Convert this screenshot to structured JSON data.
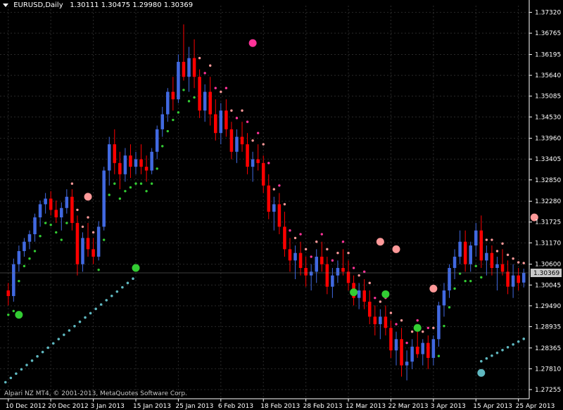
{
  "window": {
    "title_symbol": "EURUSD,Daily",
    "ohlc": "1.30111 1.30475 1.29980 1.30369",
    "copyright": "Alpari NZ MT4, © 2001-2013, MetaQuotes Software Corp."
  },
  "colors": {
    "background": "#000000",
    "bull": "#4169e1",
    "bear": "#ff0000",
    "grid": "#2a2a2a",
    "sar_down": "#ff3399",
    "sar_down_light": "#ff9999",
    "sar_up": "#33cc33",
    "sar_up_slow": "#5fb8c0",
    "current_price_box": "#c8c8c8"
  },
  "chart_data": {
    "type": "candlestick",
    "symbol": "EURUSD",
    "timeframe": "Daily",
    "ylim": [
      1.2701,
      1.375
    ],
    "y_ticks": [
      "1.37320",
      "1.36765",
      "1.36195",
      "1.35640",
      "1.35085",
      "1.34530",
      "1.33960",
      "1.33405",
      "1.32850",
      "1.32280",
      "1.31725",
      "1.31170",
      "1.30600",
      "1.30045",
      "1.29490",
      "1.28935",
      "1.28365",
      "1.27810",
      "1.27255"
    ],
    "current_price": "1.30369",
    "x_labels": [
      "10 Dec 2012",
      "20 Dec 2012",
      "3 Jan 2013",
      "15 Jan 2013",
      "25 Jan 2013",
      "6 Feb 2013",
      "18 Feb 2013",
      "28 Feb 2013",
      "12 Mar 2013",
      "22 Mar 2013",
      "3 Apr 2013",
      "15 Apr 2013",
      "25 Apr 2013"
    ],
    "x_label_index": [
      0,
      8,
      16,
      24,
      32,
      40,
      48,
      56,
      64,
      72,
      80,
      88,
      96
    ],
    "candles": [
      [
        1.299,
        1.301,
        1.295,
        1.2975
      ],
      [
        1.2975,
        1.3075,
        1.296,
        1.306
      ],
      [
        1.306,
        1.311,
        1.304,
        1.3095
      ],
      [
        1.3095,
        1.313,
        1.308,
        1.312
      ],
      [
        1.312,
        1.315,
        1.31,
        1.314
      ],
      [
        1.314,
        1.3195,
        1.312,
        1.3185
      ],
      [
        1.3185,
        1.323,
        1.316,
        1.322
      ],
      [
        1.322,
        1.325,
        1.3195,
        1.3235
      ],
      [
        1.3235,
        1.3255,
        1.319,
        1.3205
      ],
      [
        1.3205,
        1.323,
        1.317,
        1.3185
      ],
      [
        1.3185,
        1.3225,
        1.315,
        1.321
      ],
      [
        1.321,
        1.326,
        1.3195,
        1.324
      ],
      [
        1.324,
        1.326,
        1.315,
        1.317
      ],
      [
        1.317,
        1.319,
        1.303,
        1.306
      ],
      [
        1.306,
        1.3145,
        1.304,
        1.313
      ],
      [
        1.313,
        1.317,
        1.308,
        1.31
      ],
      [
        1.31,
        1.313,
        1.306,
        1.308
      ],
      [
        1.308,
        1.3175,
        1.307,
        1.316
      ],
      [
        1.316,
        1.332,
        1.315,
        1.331
      ],
      [
        1.331,
        1.34,
        1.327,
        1.338
      ],
      [
        1.338,
        1.342,
        1.33,
        1.333
      ],
      [
        1.333,
        1.336,
        1.326,
        1.33
      ],
      [
        1.33,
        1.337,
        1.328,
        1.335
      ],
      [
        1.335,
        1.338,
        1.329,
        1.332
      ],
      [
        1.332,
        1.336,
        1.33,
        1.334
      ],
      [
        1.334,
        1.338,
        1.33,
        1.332
      ],
      [
        1.332,
        1.335,
        1.328,
        1.331
      ],
      [
        1.331,
        1.337,
        1.33,
        1.336
      ],
      [
        1.336,
        1.343,
        1.334,
        1.342
      ],
      [
        1.342,
        1.348,
        1.34,
        1.346
      ],
      [
        1.346,
        1.353,
        1.344,
        1.352
      ],
      [
        1.352,
        1.356,
        1.347,
        1.35
      ],
      [
        1.35,
        1.362,
        1.349,
        1.36
      ],
      [
        1.36,
        1.37,
        1.355,
        1.356
      ],
      [
        1.356,
        1.364,
        1.352,
        1.361
      ],
      [
        1.361,
        1.366,
        1.353,
        1.356
      ],
      [
        1.356,
        1.358,
        1.345,
        1.347
      ],
      [
        1.347,
        1.354,
        1.344,
        1.352
      ],
      [
        1.352,
        1.356,
        1.343,
        1.346
      ],
      [
        1.346,
        1.35,
        1.339,
        1.341
      ],
      [
        1.341,
        1.349,
        1.338,
        1.347
      ],
      [
        1.347,
        1.35,
        1.34,
        1.342
      ],
      [
        1.342,
        1.344,
        1.334,
        1.336
      ],
      [
        1.336,
        1.342,
        1.333,
        1.34
      ],
      [
        1.34,
        1.344,
        1.336,
        1.338
      ],
      [
        1.338,
        1.341,
        1.33,
        1.332
      ],
      [
        1.332,
        1.336,
        1.328,
        1.334
      ],
      [
        1.334,
        1.338,
        1.331,
        1.333
      ],
      [
        1.333,
        1.335,
        1.325,
        1.327
      ],
      [
        1.327,
        1.33,
        1.318,
        1.32
      ],
      [
        1.32,
        1.324,
        1.315,
        1.322
      ],
      [
        1.322,
        1.325,
        1.314,
        1.316
      ],
      [
        1.316,
        1.32,
        1.308,
        1.31
      ],
      [
        1.31,
        1.313,
        1.304,
        1.307
      ],
      [
        1.307,
        1.311,
        1.302,
        1.309
      ],
      [
        1.309,
        1.312,
        1.303,
        1.305
      ],
      [
        1.305,
        1.308,
        1.3,
        1.303
      ],
      [
        1.303,
        1.306,
        1.299,
        1.304
      ],
      [
        1.304,
        1.31,
        1.301,
        1.308
      ],
      [
        1.308,
        1.312,
        1.304,
        1.306
      ],
      [
        1.306,
        1.308,
        1.298,
        1.3
      ],
      [
        1.3,
        1.305,
        1.297,
        1.303
      ],
      [
        1.303,
        1.307,
        1.301,
        1.305
      ],
      [
        1.305,
        1.31,
        1.303,
        1.304
      ],
      [
        1.304,
        1.307,
        1.299,
        1.301
      ],
      [
        1.301,
        1.303,
        1.295,
        1.297
      ],
      [
        1.297,
        1.301,
        1.294,
        1.299
      ],
      [
        1.299,
        1.302,
        1.294,
        1.296
      ],
      [
        1.296,
        1.299,
        1.29,
        1.292
      ],
      [
        1.292,
        1.295,
        1.287,
        1.29
      ],
      [
        1.29,
        1.294,
        1.286,
        1.292
      ],
      [
        1.292,
        1.295,
        1.287,
        1.289
      ],
      [
        1.289,
        1.291,
        1.281,
        1.283
      ],
      [
        1.283,
        1.288,
        1.279,
        1.286
      ],
      [
        1.286,
        1.289,
        1.276,
        1.279
      ],
      [
        1.279,
        1.283,
        1.275,
        1.28
      ],
      [
        1.28,
        1.286,
        1.278,
        1.284
      ],
      [
        1.284,
        1.289,
        1.281,
        1.282
      ],
      [
        1.282,
        1.286,
        1.279,
        1.285
      ],
      [
        1.285,
        1.287,
        1.278,
        1.281
      ],
      [
        1.281,
        1.287,
        1.279,
        1.286
      ],
      [
        1.286,
        1.296,
        1.284,
        1.295
      ],
      [
        1.295,
        1.301,
        1.292,
        1.299
      ],
      [
        1.299,
        1.306,
        1.297,
        1.305
      ],
      [
        1.305,
        1.31,
        1.302,
        1.308
      ],
      [
        1.308,
        1.315,
        1.306,
        1.312
      ],
      [
        1.312,
        1.315,
        1.304,
        1.306
      ],
      [
        1.306,
        1.312,
        1.304,
        1.311
      ],
      [
        1.311,
        1.317,
        1.308,
        1.315
      ],
      [
        1.315,
        1.319,
        1.305,
        1.307
      ],
      [
        1.307,
        1.311,
        1.303,
        1.309
      ],
      [
        1.309,
        1.311,
        1.303,
        1.305
      ],
      [
        1.305,
        1.308,
        1.299,
        1.306
      ],
      [
        1.306,
        1.31,
        1.303,
        1.304
      ],
      [
        1.304,
        1.307,
        1.298,
        1.3
      ],
      [
        1.3,
        1.306,
        1.297,
        1.303
      ],
      [
        1.303,
        1.305,
        1.299,
        1.301
      ],
      [
        1.3011,
        1.3048,
        1.2998,
        1.3037
      ]
    ],
    "sar_slow": {
      "start_index": 0,
      "start_price": 1.2745,
      "step": 0.00072,
      "end_index": 24,
      "reset_price": 1.2801,
      "reset_index": 80,
      "step2": 0.00068
    },
    "markers": [
      {
        "index": 2,
        "price": 1.2925,
        "kind": "up"
      },
      {
        "index": 15,
        "price": 1.324,
        "kind": "down_light"
      },
      {
        "index": 24,
        "price": 1.305,
        "kind": "up"
      },
      {
        "index": 46,
        "price": 1.365,
        "kind": "down"
      },
      {
        "index": 70,
        "price": 1.312,
        "kind": "down_light"
      },
      {
        "index": 73,
        "price": 1.31,
        "kind": "down_light"
      },
      {
        "index": 65,
        "price": 1.2985,
        "kind": "up"
      },
      {
        "index": 71,
        "price": 1.298,
        "kind": "up"
      },
      {
        "index": 77,
        "price": 1.289,
        "kind": "up"
      },
      {
        "index": 80,
        "price": 1.2995,
        "kind": "down_light"
      },
      {
        "index": 89,
        "price": 1.277,
        "kind": "slow"
      },
      {
        "index": 99,
        "price": 1.3185,
        "kind": "down_light"
      }
    ]
  }
}
